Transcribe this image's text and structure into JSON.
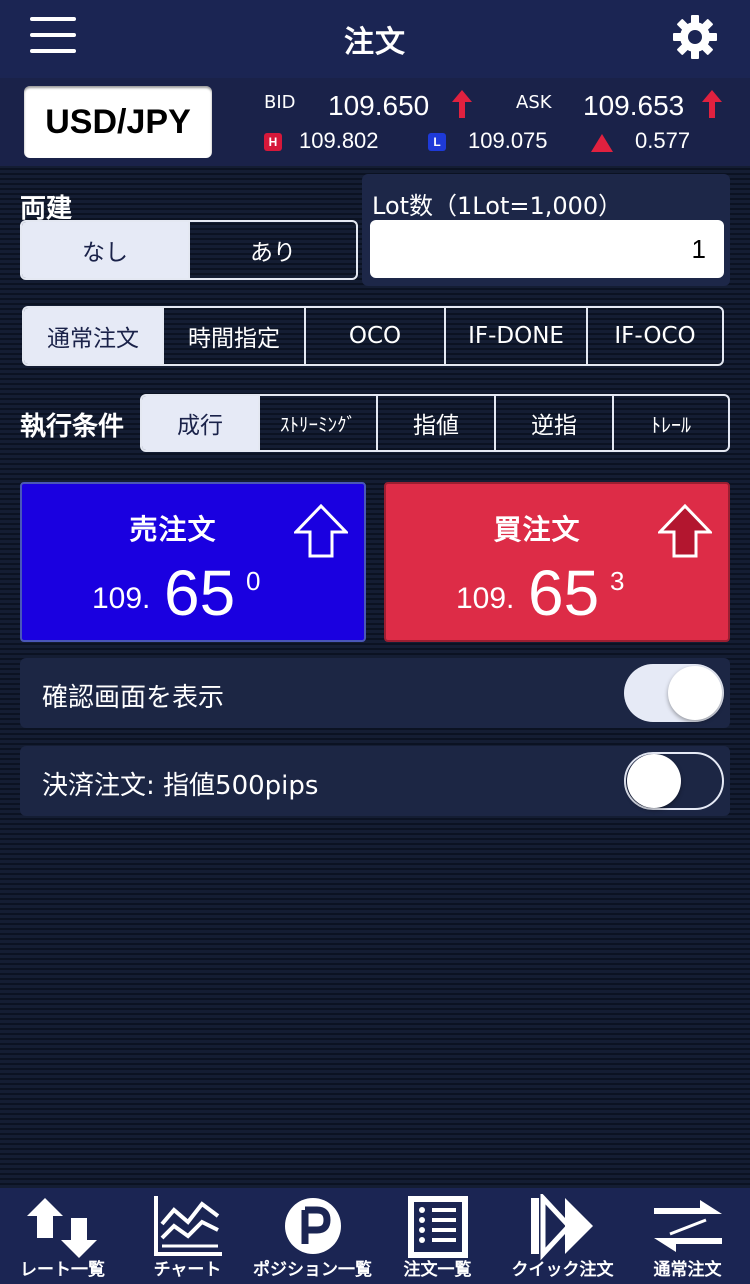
{
  "header": {
    "title": "注文"
  },
  "rate": {
    "pair": "USD/JPY",
    "bid_label": "BID",
    "bid": "109.650",
    "ask_label": "ASK",
    "ask": "109.653",
    "high_badge": "H",
    "high": "109.802",
    "low_badge": "L",
    "low": "109.075",
    "change": "0.577"
  },
  "ryodate": {
    "label": "両建",
    "options": [
      "なし",
      "あり"
    ],
    "selected": "なし"
  },
  "lot": {
    "label": "Lot数（1Lot=1,000）",
    "value": "1"
  },
  "order_types": {
    "options": [
      "通常注文",
      "時間指定",
      "OCO",
      "IF-DONE",
      "IF-OCO"
    ],
    "selected": "通常注文"
  },
  "exec": {
    "label": "執行条件",
    "options": [
      "成行",
      "ｽﾄﾘｰﾐﾝｸﾞ",
      "指値",
      "逆指",
      "ﾄﾚｰﾙ"
    ],
    "selected": "成行"
  },
  "sell": {
    "title": "売注文",
    "price_prefix": "109.",
    "price_main": "65",
    "price_pip": "0"
  },
  "buy": {
    "title": "買注文",
    "price_prefix": "109.",
    "price_main": "65",
    "price_pip": "3"
  },
  "confirm_toggle": {
    "label": "確認画面を表示",
    "on": true
  },
  "settle_toggle": {
    "label": "決済注文: 指値500pips",
    "on": false
  },
  "tabs": [
    {
      "label": "レート一覧",
      "icon": "rate-list-icon"
    },
    {
      "label": "チャート",
      "icon": "chart-icon"
    },
    {
      "label": "ポジション一覧",
      "icon": "position-icon"
    },
    {
      "label": "注文一覧",
      "icon": "order-list-icon"
    },
    {
      "label": "クイック注文",
      "icon": "quick-order-icon"
    },
    {
      "label": "通常注文",
      "icon": "normal-order-icon"
    }
  ],
  "colors": {
    "sell": "#1a00e0",
    "buy": "#dd2c47",
    "header": "#1b2553",
    "up": "#e0213f"
  }
}
